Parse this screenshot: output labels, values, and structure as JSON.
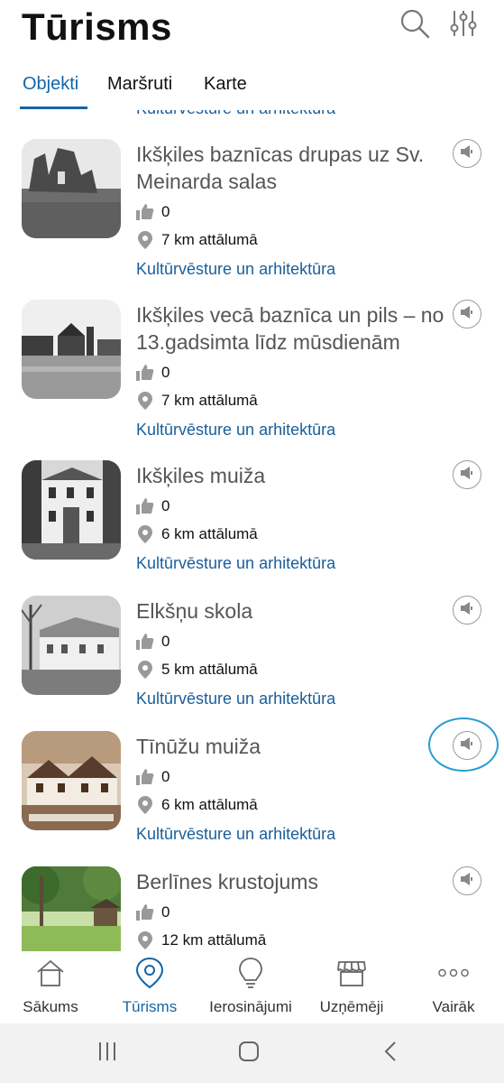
{
  "header": {
    "title": "Tūrisms",
    "search_icon": "search-icon",
    "filter_icon": "sliders-icon"
  },
  "tabs": [
    {
      "label": "Objekti",
      "active": true
    },
    {
      "label": "Maršruti",
      "active": false
    },
    {
      "label": "Karte",
      "active": false
    }
  ],
  "list": {
    "partial_category": "Kultūrvēsture un arhitektūra",
    "items": [
      {
        "title": "Ikšķiles baznīcas drupas uz Sv. Meinarda salas",
        "likes": "0",
        "distance": "7 km attālumā",
        "category": "Kultūrvēsture un arhitektūra"
      },
      {
        "title": "Ikšķiles vecā baznīca un pils – no 13.gadsimta līdz mūsdienām",
        "likes": "0",
        "distance": "7 km attālumā",
        "category": "Kultūrvēsture un arhitektūra"
      },
      {
        "title": "Ikšķiles muiža",
        "likes": "0",
        "distance": "6 km attālumā",
        "category": "Kultūrvēsture un arhitektūra"
      },
      {
        "title": "Elkšņu skola",
        "likes": "0",
        "distance": "5 km attālumā",
        "category": "Kultūrvēsture un arhitektūra"
      },
      {
        "title": "Tīnūžu muiža",
        "likes": "0",
        "distance": "6 km attālumā",
        "category": "Kultūrvēsture un arhitektūra"
      },
      {
        "title": "Berlīnes krustojums",
        "likes": "0",
        "distance": "12 km attālumā",
        "category": ""
      }
    ]
  },
  "bottom_nav": [
    {
      "label": "Sākums",
      "icon": "home-icon",
      "active": false
    },
    {
      "label": "Tūrisms",
      "icon": "map-pin-icon",
      "active": true
    },
    {
      "label": "Ierosinājumi",
      "icon": "lightbulb-icon",
      "active": false
    },
    {
      "label": "Uzņēmēji",
      "icon": "store-icon",
      "active": false
    },
    {
      "label": "Vairāk",
      "icon": "more-dots-icon",
      "active": false
    }
  ],
  "colors": {
    "accent": "#1565a6",
    "category": "#1a5e9a",
    "title_gray": "#555555",
    "highlight": "#2a9bd4"
  }
}
